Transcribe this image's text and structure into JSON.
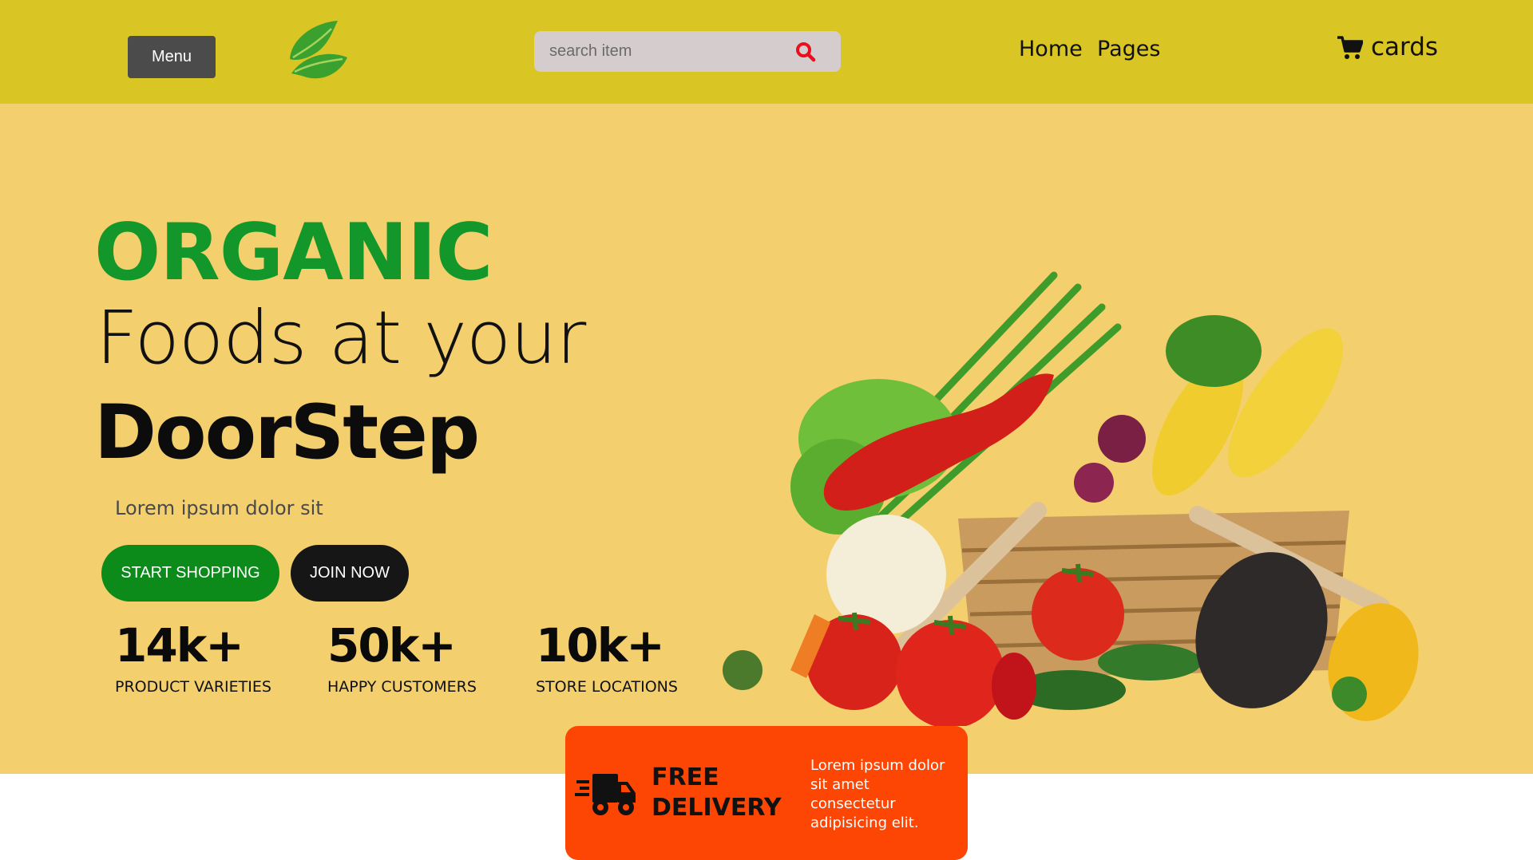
{
  "header": {
    "menu_label": "Menu",
    "search_placeholder": "search item",
    "nav": [
      {
        "label": "Home"
      },
      {
        "label": "Pages"
      }
    ],
    "cart_label": "cards"
  },
  "hero": {
    "line1": "ORGANIC",
    "line2": "Foods at your",
    "line3": "DoorStep",
    "subtitle": "Lorem ipsum dolor sit",
    "primary_button": "START SHOPPING",
    "secondary_button": "JOIN NOW",
    "stats": [
      {
        "value": "14k+",
        "label": "PRODUCT VARIETIES"
      },
      {
        "value": "50k+",
        "label": "HAPPY CUSTOMERS"
      },
      {
        "value": "10k+",
        "label": "STORE LOCATIONS"
      }
    ]
  },
  "delivery": {
    "title": "FREE DELIVERY",
    "text": "Lorem ipsum dolor sit amet consectetur adipisicing elit."
  },
  "icons": [
    "leaf-logo-icon",
    "search-icon",
    "cart-icon",
    "delivery-truck-icon"
  ],
  "colors": {
    "header_bg": "#d9c524",
    "hero_bg": "#f3cf6e",
    "organic_green": "#13972a",
    "shop_button": "#0c8a1a",
    "join_button": "#161616",
    "delivery_bg": "#fd4604",
    "search_icon": "#e8101c"
  }
}
